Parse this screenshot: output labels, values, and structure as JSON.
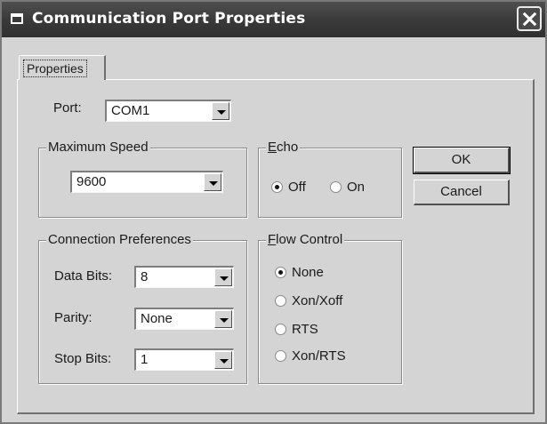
{
  "window": {
    "title": "Communication Port Properties"
  },
  "tabs": [
    {
      "label": "Properties",
      "active": true
    }
  ],
  "port": {
    "label": "Port:",
    "value": "COM1"
  },
  "max_speed": {
    "title": "Maximum Speed",
    "value": "9600"
  },
  "echo": {
    "title_access": "E",
    "title_rest": "cho",
    "options": [
      {
        "label": "Off",
        "selected": true
      },
      {
        "label": "On",
        "selected": false
      }
    ]
  },
  "connection": {
    "title": "Connection Preferences",
    "data_bits": {
      "label": "Data Bits:",
      "value": "8"
    },
    "parity": {
      "label": "Parity:",
      "value": "None"
    },
    "stop_bits": {
      "label": "Stop Bits:",
      "value": "1"
    }
  },
  "flow_control": {
    "title_access": "F",
    "title_rest": "low Control",
    "options": [
      {
        "label": "None",
        "selected": true
      },
      {
        "label": "Xon/Xoff",
        "selected": false
      },
      {
        "label": "RTS",
        "selected": false
      },
      {
        "label": "Xon/RTS",
        "selected": false
      }
    ]
  },
  "buttons": {
    "ok": "OK",
    "cancel": "Cancel"
  },
  "icons": {
    "title_icon": "window-icon",
    "close_icon": "close-icon",
    "dropdown_icon": "chevron-down-icon"
  },
  "colors": {
    "titlebar": "#3a3a3a",
    "face": "#d4d4d4",
    "field": "#ffffff"
  }
}
